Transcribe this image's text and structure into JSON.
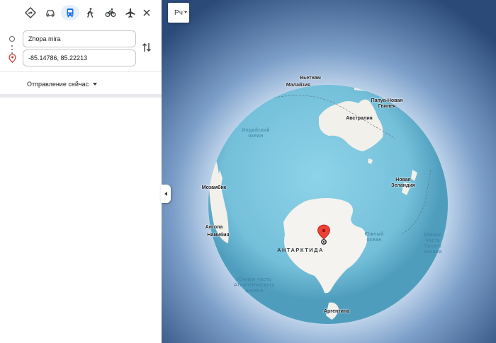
{
  "travel_modes": [
    {
      "name": "best-route",
      "icon": "diamond-directions-icon",
      "active": false
    },
    {
      "name": "driving",
      "icon": "car-icon",
      "active": false
    },
    {
      "name": "transit",
      "icon": "bus-icon",
      "active": true
    },
    {
      "name": "walking",
      "icon": "walk-icon",
      "active": false
    },
    {
      "name": "cycling",
      "icon": "bicycle-icon",
      "active": false
    },
    {
      "name": "flight",
      "icon": "airplane-icon",
      "active": false
    }
  ],
  "route": {
    "origin": "Zhopa mira",
    "destination": "-85.14786, 85.22213"
  },
  "departure": {
    "label": "Отправление сейчас"
  },
  "map": {
    "layers_button_text": "Рч",
    "labels": {
      "vietnam": "Вьетнам",
      "malaysia": "Малайзия",
      "papua": "Папуа-Новая Гвинея",
      "australia": "Австралия",
      "indian_ocean": "Индийский океан",
      "mozambique": "Мозамбик",
      "new_zealand": "Новая Зеландия",
      "angola": "Ангола",
      "namibia": "Намибия",
      "south_ocean": "Южный океан",
      "antarctica": "АНТАРКТИДА",
      "south_pacific": "Южная часть Тихого океана",
      "south_atlantic": "Южная часть Атлантического океана",
      "argentina": "Аргентина"
    },
    "colors": {
      "ocean": "#7ec6de",
      "land": "#f2f0ea",
      "space": "#2b4a78",
      "halo": "#ffffff",
      "pin": "#ea4335"
    }
  }
}
